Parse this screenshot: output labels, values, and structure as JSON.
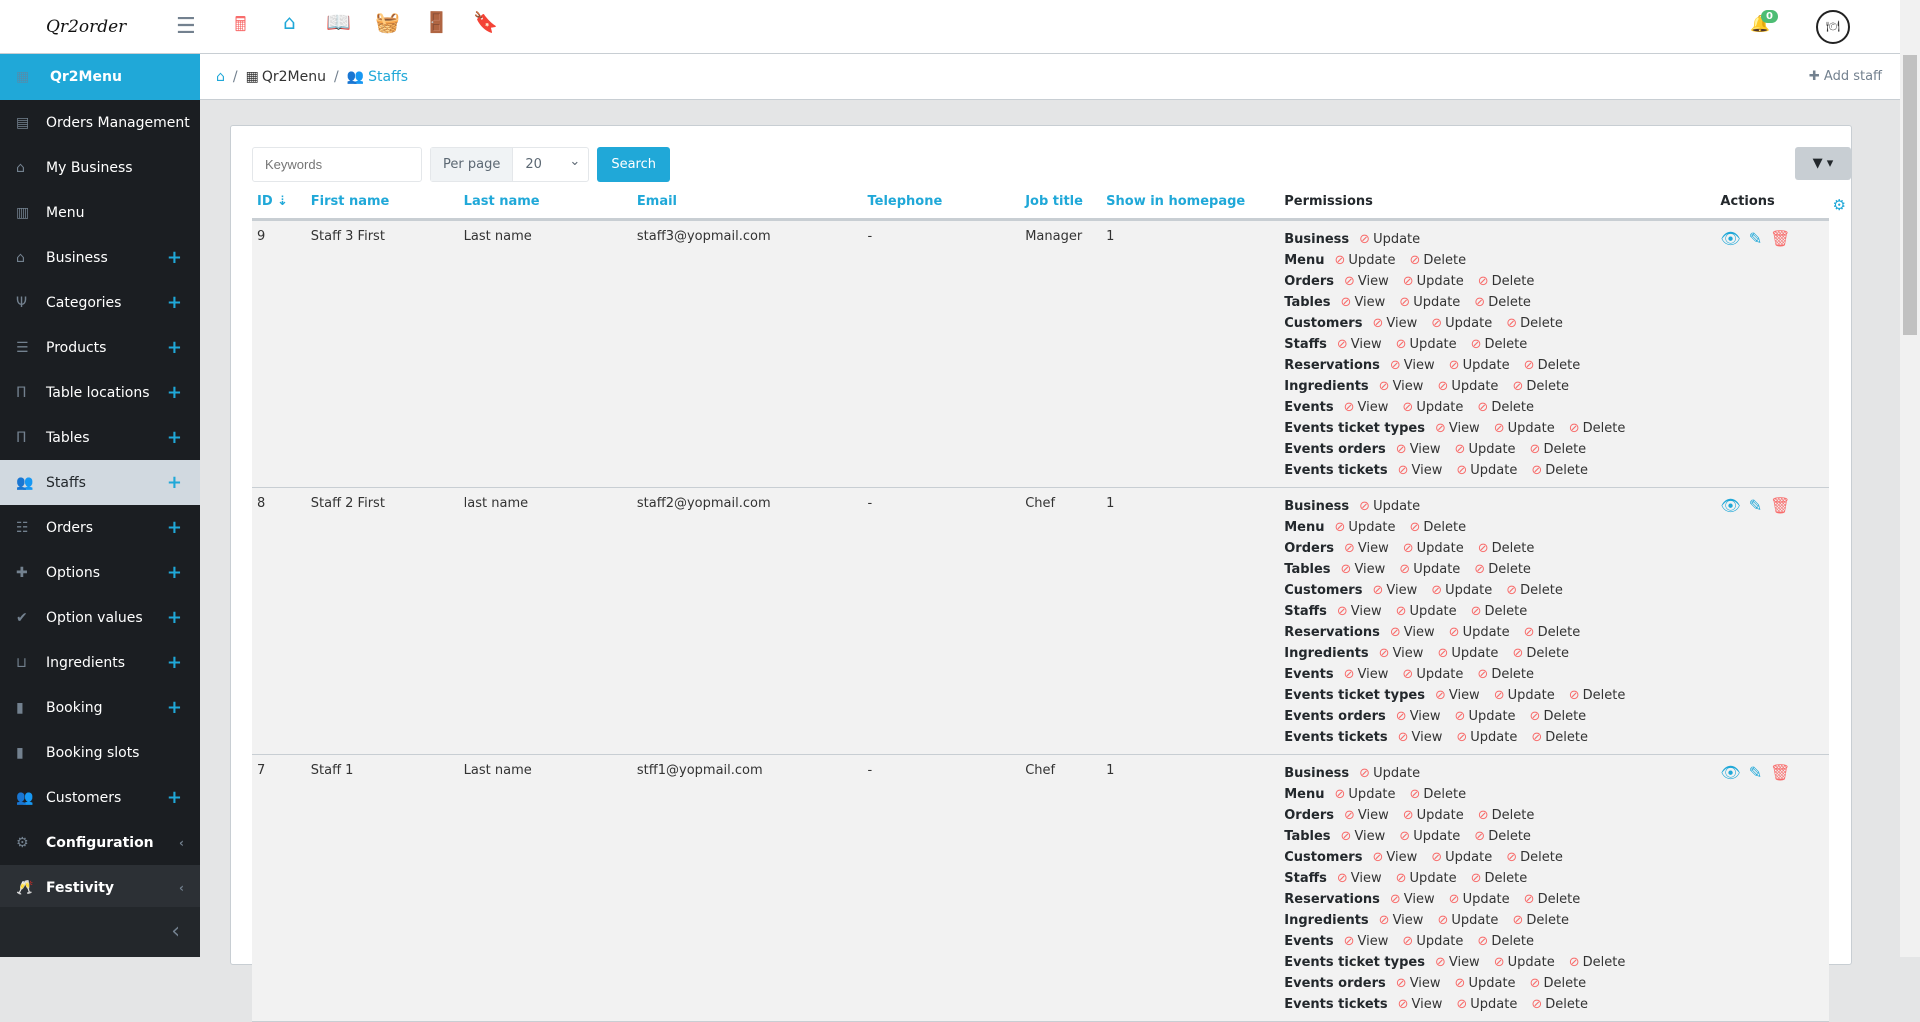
{
  "topbar": {
    "logo": "Qr2order",
    "notifications": "0",
    "icons": [
      {
        "name": "cash-register-icon",
        "glyph": "🖩",
        "color": "#f86c6b"
      },
      {
        "name": "store-icon",
        "glyph": "⌂",
        "color": "#20a8d8"
      },
      {
        "name": "book-open-icon",
        "glyph": "📖",
        "color": "#63c2de"
      },
      {
        "name": "basket-icon",
        "glyph": "🧺",
        "color": "#ffc107"
      },
      {
        "name": "door-open-icon",
        "glyph": "🚪",
        "color": "#4dbd74"
      },
      {
        "name": "bookmark-icon",
        "glyph": "🔖",
        "color": "#20a8d8"
      }
    ]
  },
  "sidebar": {
    "header": "Qr2Menu",
    "items": [
      {
        "label": "Orders Management",
        "icon": "cash-register-icon",
        "glyph": "▤",
        "plus": false
      },
      {
        "label": "My Business",
        "icon": "store-icon",
        "glyph": "⌂",
        "plus": false
      },
      {
        "label": "Menu",
        "icon": "book-icon",
        "glyph": "▥",
        "plus": false
      },
      {
        "label": "Business",
        "icon": "store-icon",
        "glyph": "⌂",
        "plus": true
      },
      {
        "label": "Categories",
        "icon": "utensils-icon",
        "glyph": "Ψ",
        "plus": true
      },
      {
        "label": "Products",
        "icon": "list-icon",
        "glyph": "☰",
        "plus": true
      },
      {
        "label": "Table locations",
        "icon": "chair-icon",
        "glyph": "П",
        "plus": true
      },
      {
        "label": "Tables",
        "icon": "chair-icon",
        "glyph": "П",
        "plus": true
      },
      {
        "label": "Staffs",
        "icon": "users-icon",
        "glyph": "👥",
        "plus": true,
        "active": true
      },
      {
        "label": "Orders",
        "icon": "list-ul-icon",
        "glyph": "☷",
        "plus": true
      },
      {
        "label": "Options",
        "icon": "puzzle-icon",
        "glyph": "✚",
        "plus": true
      },
      {
        "label": "Option values",
        "icon": "check-circle-icon",
        "glyph": "✔",
        "plus": true
      },
      {
        "label": "Ingredients",
        "icon": "basket-icon",
        "glyph": "⊔",
        "plus": true
      },
      {
        "label": "Booking",
        "icon": "bookmark-icon",
        "glyph": "▮",
        "plus": true
      },
      {
        "label": "Booking slots",
        "icon": "bookmark-icon",
        "glyph": "▮",
        "plus": false
      },
      {
        "label": "Customers",
        "icon": "users-icon",
        "glyph": "👥",
        "plus": true
      },
      {
        "label": "Configuration",
        "icon": "cogs-icon",
        "glyph": "⚙",
        "plus": false,
        "group": true
      },
      {
        "label": "Festivity",
        "icon": "glasses-cheers-icon",
        "glyph": "🥂",
        "plus": false,
        "group": true
      }
    ]
  },
  "breadcrumb": {
    "items": [
      "Qr2Menu",
      "Staffs"
    ],
    "add_staff": "Add staff"
  },
  "filters": {
    "keywords_placeholder": "Keywords",
    "per_page_label": "Per page",
    "per_page_value": "20",
    "search_label": "Search"
  },
  "table": {
    "headers": [
      "ID",
      "First name",
      "Last name",
      "Email",
      "Telephone",
      "Job title",
      "Show in homepage",
      "Permissions",
      "Actions"
    ],
    "rows": [
      {
        "id": "9",
        "first": "Staff 3 First",
        "last": "Last name",
        "email": "staff3@yopmail.com",
        "tel": "-",
        "job": "Manager",
        "show": "1"
      },
      {
        "id": "8",
        "first": "Staff 2 First",
        "last": "last name",
        "email": "staff2@yopmail.com",
        "tel": "-",
        "job": "Chef",
        "show": "1"
      },
      {
        "id": "7",
        "first": "Staff 1",
        "last": "Last name",
        "email": "stff1@yopmail.com",
        "tel": "-",
        "job": "Chef",
        "show": "1"
      }
    ],
    "permissions": [
      {
        "module": "Business",
        "perms": [
          "Update"
        ]
      },
      {
        "module": "Menu",
        "perms": [
          "Update",
          "Delete"
        ]
      },
      {
        "module": "Orders",
        "perms": [
          "View",
          "Update",
          "Delete"
        ]
      },
      {
        "module": "Tables",
        "perms": [
          "View",
          "Update",
          "Delete"
        ]
      },
      {
        "module": "Customers",
        "perms": [
          "View",
          "Update",
          "Delete"
        ]
      },
      {
        "module": "Staffs",
        "perms": [
          "View",
          "Update",
          "Delete"
        ]
      },
      {
        "module": "Reservations",
        "perms": [
          "View",
          "Update",
          "Delete"
        ]
      },
      {
        "module": "Ingredients",
        "perms": [
          "View",
          "Update",
          "Delete"
        ]
      },
      {
        "module": "Events",
        "perms": [
          "View",
          "Update",
          "Delete"
        ]
      },
      {
        "module": "Events ticket types",
        "perms": [
          "View",
          "Update",
          "Delete"
        ]
      },
      {
        "module": "Events orders",
        "perms": [
          "View",
          "Update",
          "Delete"
        ]
      },
      {
        "module": "Events tickets",
        "perms": [
          "View",
          "Update",
          "Delete"
        ]
      }
    ]
  },
  "colors": {
    "accent": "#20a8d8",
    "danger": "#f86c6b",
    "sidebar": "#1b1e22"
  }
}
